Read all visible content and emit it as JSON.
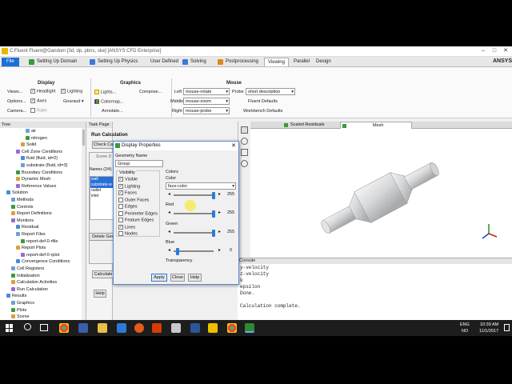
{
  "window": {
    "title": "C:Fluent Fluent@Gandom [3d, dp, pbns, ske] [ANSYS CFD Enterprise]"
  },
  "tabs": [
    "File",
    "Setting Up Domain",
    "Setting Up Physics",
    "User Defined",
    "Solving",
    "Postprocessing",
    "Viewing",
    "Parallel",
    "Design"
  ],
  "ribbon": {
    "display_group": "Display",
    "views": "Views...",
    "options": "Options...",
    "camera": "Camera...",
    "headlight": "Headlight",
    "lighting": "Lighting",
    "axes": "Axes",
    "ruler": "Ruler",
    "gouraud": "Gouraud",
    "graphics_group": "Graphics",
    "lights": "Lights...",
    "colormap": "Colormap...",
    "annotate": "Annotate...",
    "compose": "Compose...",
    "mouse_group": "Mouse",
    "left_label": "Left",
    "left_value": "mouse-rotate",
    "middle_label": "Middle",
    "middle_value": "mouse-zoom",
    "right_label": "Right",
    "right_value": "mouse-probe",
    "probe_label": "Probe",
    "probe_value": "short description",
    "fluent_defaults": "Fluent Defaults",
    "workbench_defaults": "Workbench Defaults"
  },
  "tree": {
    "header": "Tree",
    "items": [
      {
        "label": "air",
        "indent": 5
      },
      {
        "label": "nitrogen",
        "indent": 5
      },
      {
        "label": "Solid",
        "indent": 4
      },
      {
        "label": "Cell Zone Conditions",
        "indent": 3
      },
      {
        "label": "fluid (fluid, id=2)",
        "indent": 4
      },
      {
        "label": "substrate (fluid, id=3)",
        "indent": 4
      },
      {
        "label": "Boundary Conditions",
        "indent": 3
      },
      {
        "label": "Dynamic Mesh",
        "indent": 3
      },
      {
        "label": "Reference Values",
        "indent": 3
      },
      {
        "label": "Solution",
        "indent": 1
      },
      {
        "label": "Methods",
        "indent": 2
      },
      {
        "label": "Controls",
        "indent": 2
      },
      {
        "label": "Report Definitions",
        "indent": 2
      },
      {
        "label": "Monitors",
        "indent": 2
      },
      {
        "label": "Residual",
        "indent": 3
      },
      {
        "label": "Report Files",
        "indent": 3
      },
      {
        "label": "report-def-0-rfile",
        "indent": 4
      },
      {
        "label": "Report Plots",
        "indent": 3
      },
      {
        "label": "report-def-0-rplot",
        "indent": 4
      },
      {
        "label": "Convergence Conditions",
        "indent": 3
      },
      {
        "label": "Cell Registers",
        "indent": 2
      },
      {
        "label": "Initialization",
        "indent": 2
      },
      {
        "label": "Calculation Activities",
        "indent": 2
      },
      {
        "label": "Run Calculation",
        "indent": 2
      },
      {
        "label": "Results",
        "indent": 1
      },
      {
        "label": "Graphics",
        "indent": 2
      },
      {
        "label": "Plots",
        "indent": 2
      },
      {
        "label": "Scene",
        "indent": 2
      }
    ]
  },
  "taskpage": {
    "header": "Task Page",
    "title": "Run Calculation",
    "check_case": "Check Ca",
    "scene_desc": "Scene D",
    "names_label": "Names (2/4)",
    "names": [
      "wall",
      "substrate-w",
      "outlet",
      "inlet"
    ],
    "delete_geo": "Delete Geo",
    "calculate": "Calculate",
    "help": "Help"
  },
  "dialog": {
    "title": "Display Properties",
    "geometry_name_label": "Geometry Name",
    "geometry_name": "Group",
    "visibility_label": "Visibility",
    "visibility": [
      {
        "label": "Visible",
        "checked": true
      },
      {
        "label": "Lighting",
        "checked": true
      },
      {
        "label": "Faces",
        "checked": true
      },
      {
        "label": "Outer Faces",
        "checked": false
      },
      {
        "label": "Edges",
        "checked": false
      },
      {
        "label": "Perimeter Edges",
        "checked": false
      },
      {
        "label": "Feature Edges",
        "checked": false
      },
      {
        "label": "Lines",
        "checked": true
      },
      {
        "label": "Nodes",
        "checked": false
      }
    ],
    "colors_label": "Colors",
    "color_label": "Color",
    "color_value": "face-color",
    "red_label": "Red",
    "red_value": "255",
    "green_label": "Green",
    "green_value": "255",
    "blue_label": "Blue",
    "blue_value": "0",
    "transparency_label": "Transparency",
    "apply": "Apply",
    "close": "Close",
    "help": "Help"
  },
  "viewport": {
    "tab_residuals": "Scaled Residuals",
    "tab_mesh": "Mesh"
  },
  "console": {
    "header": "Console",
    "lines": [
      "y-velocity",
      "z-velocity",
      "k",
      "epsilon",
      "Done.",
      "",
      "Calculation complete."
    ]
  },
  "taskbar": {
    "lang": "ENG",
    "region": "NO",
    "time": "10:39 AM",
    "date": "11/1/2017"
  },
  "colors": {
    "file_tab": "#1d6fd8",
    "accent": "#2a7bd8",
    "model": "#d8dadc"
  }
}
